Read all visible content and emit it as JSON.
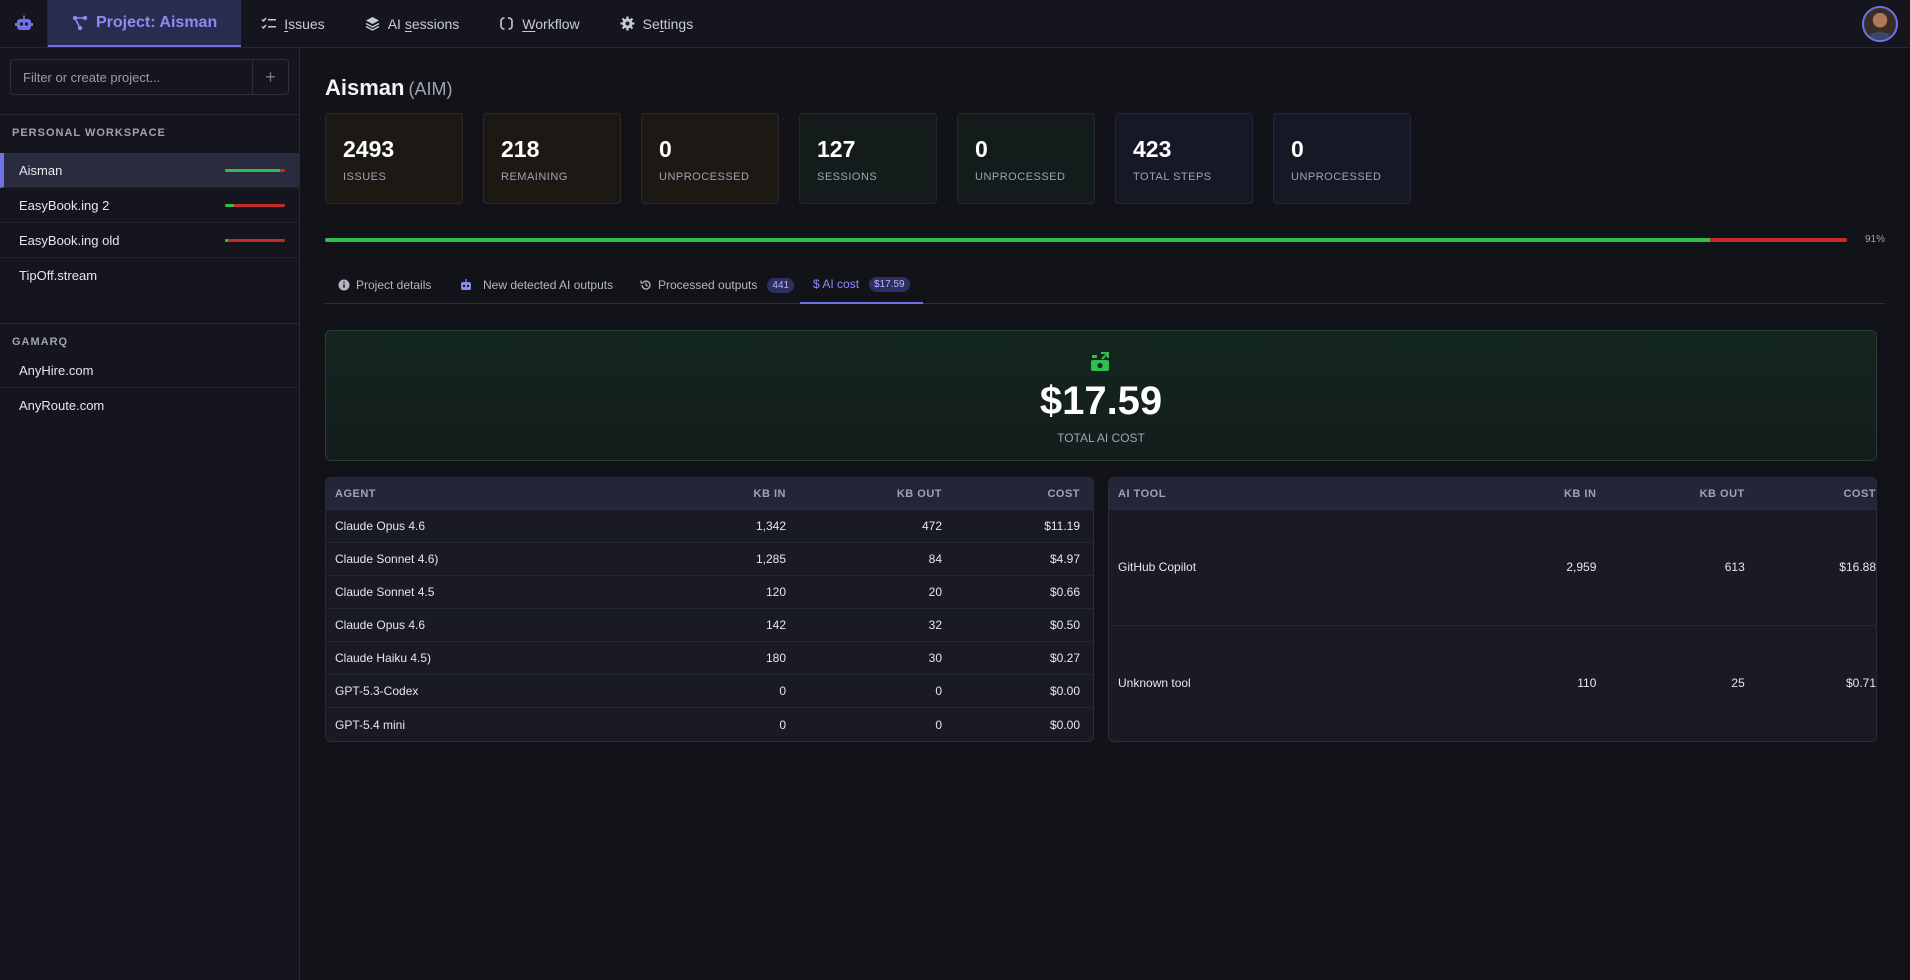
{
  "topnav": {
    "project_label": "Project: Aisman",
    "issues": {
      "pre": "",
      "u": "I",
      "post": "ssues"
    },
    "sessions": {
      "pre": "AI ",
      "u": "s",
      "post": "essions"
    },
    "workflow": {
      "pre": "",
      "u": "W",
      "post": "orkflow"
    },
    "settings": {
      "pre": "Se",
      "u": "t",
      "post": "tings"
    }
  },
  "sidebar": {
    "filter_placeholder": "Filter or create project...",
    "add_label": "+",
    "personal_title": "PERSONAL WORKSPACE",
    "personal_projects": [
      {
        "name": "Aisman",
        "progress": 0.91
      },
      {
        "name": "EasyBook.ing 2",
        "progress": 0.15
      },
      {
        "name": "EasyBook.ing old",
        "progress": 0.05
      },
      {
        "name": "TipOff.stream"
      }
    ],
    "gamarq_title": "GAMARQ",
    "gamarq_projects": [
      {
        "name": "AnyHire.com"
      },
      {
        "name": "AnyRoute.com"
      }
    ]
  },
  "main": {
    "title": "Aisman",
    "code": "(AIM)",
    "stats": [
      {
        "value": "2493",
        "label": "ISSUES"
      },
      {
        "value": "218",
        "label": "REMAINING"
      },
      {
        "value": "0",
        "label": "UNPROCESSED"
      },
      {
        "value": "127",
        "label": "SESSIONS"
      },
      {
        "value": "0",
        "label": "UNPROCESSED"
      },
      {
        "value": "423",
        "label": "TOTAL STEPS"
      },
      {
        "value": "0",
        "label": "UNPROCESSED"
      }
    ],
    "progress": 0.91,
    "progress_label": "91%",
    "tabs": {
      "details": "Project details",
      "new_outputs": "New detected AI outputs",
      "processed": "Processed outputs",
      "processed_count": "441",
      "ai_cost": "$ AI cost",
      "ai_cost_badge": "$17.59"
    },
    "total_cost": "$17.59",
    "total_cost_label": "TOTAL AI COST"
  },
  "agents_table": {
    "headers": [
      "AGENT",
      "KB IN",
      "KB OUT",
      "COST"
    ],
    "rows": [
      [
        "Claude Opus 4.6",
        "1,342",
        "472",
        "$11.19"
      ],
      [
        "Claude Sonnet 4.6)",
        "1,285",
        "84",
        "$4.97"
      ],
      [
        "Claude Sonnet 4.5",
        "120",
        "20",
        "$0.66"
      ],
      [
        "Claude Opus 4.6",
        "142",
        "32",
        "$0.50"
      ],
      [
        "Claude Haiku 4.5)",
        "180",
        "30",
        "$0.27"
      ],
      [
        "GPT-5.3-Codex",
        "0",
        "0",
        "$0.00"
      ],
      [
        "GPT-5.4 mini",
        "0",
        "0",
        "$0.00"
      ]
    ]
  },
  "tools_table": {
    "headers": [
      "AI TOOL",
      "KB IN",
      "KB OUT",
      "COST"
    ],
    "rows": [
      [
        "GitHub Copilot",
        "2,959",
        "613",
        "$16.88"
      ],
      [
        "Unknown tool",
        "110",
        "25",
        "$0.71"
      ]
    ]
  },
  "colors": {
    "accent": "#6f71e6",
    "success": "#2fbf4e",
    "danger": "#c42b2b"
  }
}
